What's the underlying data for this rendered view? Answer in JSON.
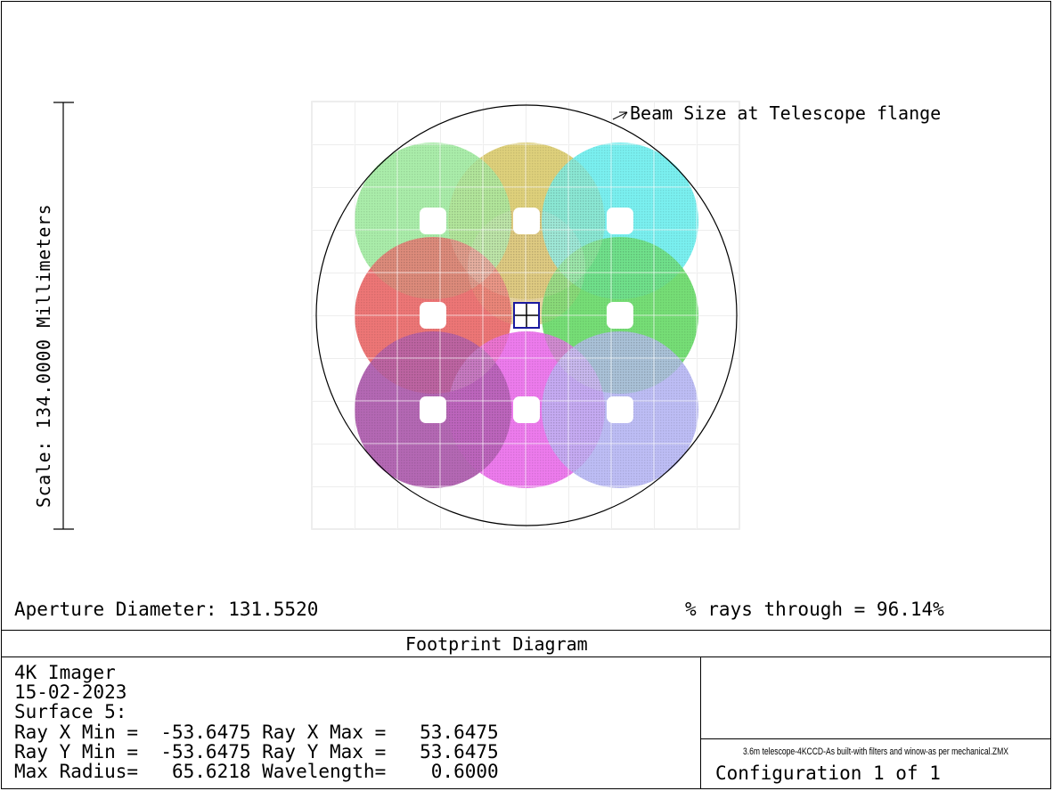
{
  "diagram": {
    "annotation": "Beam Size at Telescope flange",
    "scale_label": "Scale: 134.0000 Millimeters",
    "aperture_text": "Aperture Diameter: 131.5520",
    "rays_text": "% rays through = 96.14%",
    "colors": {
      "grid": "#c8c8c8",
      "circle": "#000000",
      "footprints": [
        "#6fe06f",
        "#c8b020",
        "#1fe6e6",
        "#e01818",
        "#caa030",
        "#18c818",
        "#800080",
        "#e020e0",
        "#9090ee"
      ]
    }
  },
  "title_bar": {
    "title": "Footprint Diagram"
  },
  "info": {
    "line1": "4K Imager",
    "line2": "15-02-2023",
    "line3": "Surface 5:",
    "line4": "Ray X Min =  -53.6475 Ray X Max =   53.6475",
    "line5": "Ray Y Min =  -53.6475 Ray Y Max =   53.6475",
    "line6": "Max Radius=   65.6218 Wavelength=    0.6000"
  },
  "file_box": {
    "filename": "3.6m telescope-4KCCD-As built-with filters and winow-as per mechanical.ZMX",
    "config": "Configuration 1 of 1"
  }
}
